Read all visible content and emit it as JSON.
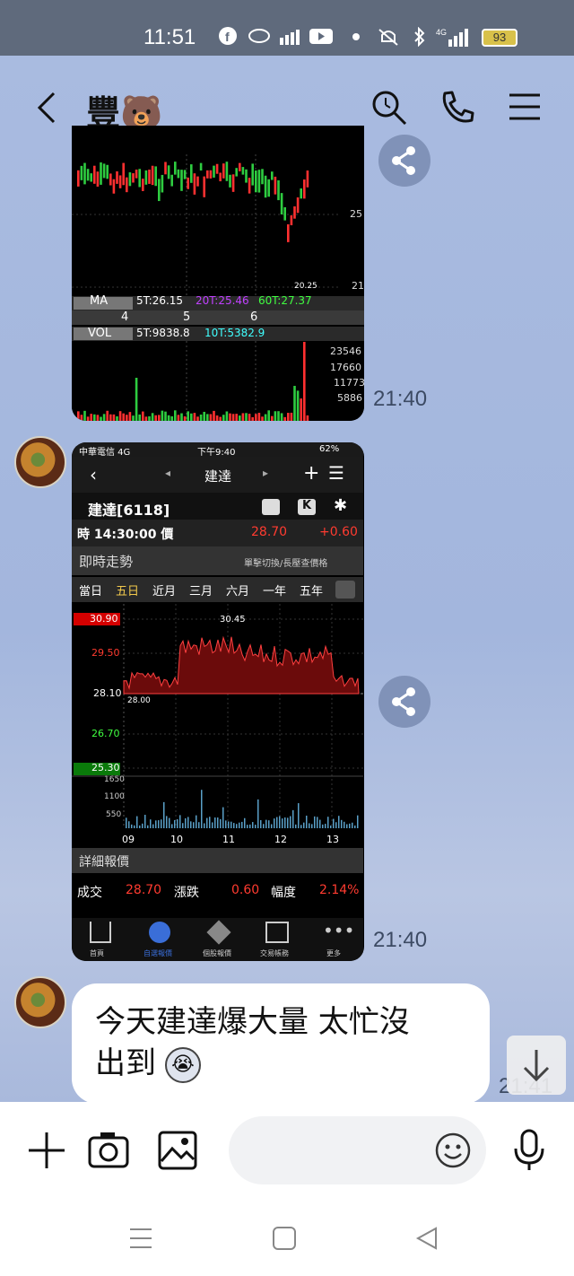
{
  "status_bar": {
    "time": "11:51",
    "battery": "93",
    "icons": [
      "facebook-icon",
      "app-icon",
      "chart-icon",
      "youtube-icon",
      "dot-icon",
      "mute-icon",
      "bluetooth-icon",
      "4g-signal-icon",
      "battery-icon"
    ]
  },
  "header": {
    "title": "豐🐻",
    "back_icon": "chevron-left-icon",
    "actions": [
      "search-icon",
      "phone-icon",
      "menu-icon"
    ]
  },
  "messages": [
    {
      "type": "image",
      "time": "21:40",
      "chart": {
        "ma_label": "MA",
        "ma_values": [
          "5T:26.15",
          "20T:25.46",
          "60T:27.37"
        ],
        "x_ticks": [
          "4",
          "5",
          "6"
        ],
        "vol_label": "VOL",
        "vol_values": [
          "5T:9838.8",
          "10T:5382.9"
        ],
        "price_ticks": [
          "25",
          "21"
        ],
        "low_label": "20.25",
        "vol_ticks": [
          "23546",
          "17660",
          "11773",
          "5886"
        ]
      }
    },
    {
      "type": "image",
      "time": "21:40",
      "app": {
        "carrier": "中華電信 4G",
        "phone_time": "下午9:40",
        "phone_battery": "62%",
        "nav_title": "建達",
        "stock_name": "建達[6118]",
        "time_label": "時 14:30:00 價",
        "price": "28.70",
        "change": "+0.60",
        "section_title": "即時走勢",
        "section_hint": "單擊切換/長壓查價格",
        "tabs": [
          "當日",
          "五日",
          "近月",
          "三月",
          "六月",
          "一年",
          "五年"
        ],
        "price_ticks": [
          "30.90",
          "29.50",
          "28.10",
          "26.70",
          "25.30"
        ],
        "high_label": "30.45",
        "low_label": "28.00",
        "vol_ticks": [
          "1650",
          "1100",
          "550"
        ],
        "x_ticks": [
          "09",
          "10",
          "11",
          "12",
          "13"
        ],
        "detail_title": "詳細報價",
        "detail": {
          "deal_label": "成交",
          "deal_value": "28.70",
          "change_label": "漲跌",
          "change_value": "0.60",
          "range_label": "幅度",
          "range_value": "2.14%"
        },
        "bottom_nav": [
          "首頁",
          "自選報價",
          "個股報價",
          "交易帳務",
          "更多"
        ]
      }
    },
    {
      "type": "text",
      "text_line1": "今天建達爆大量 太忙沒",
      "text_line2": "出到",
      "time": "21:41"
    }
  ],
  "input_bar": {
    "icons": [
      "plus-icon",
      "camera-icon",
      "image-icon",
      "emoji-icon",
      "mic-icon"
    ]
  },
  "nav_bar": {
    "icons": [
      "recent-apps-icon",
      "home-icon",
      "back-icon"
    ]
  }
}
